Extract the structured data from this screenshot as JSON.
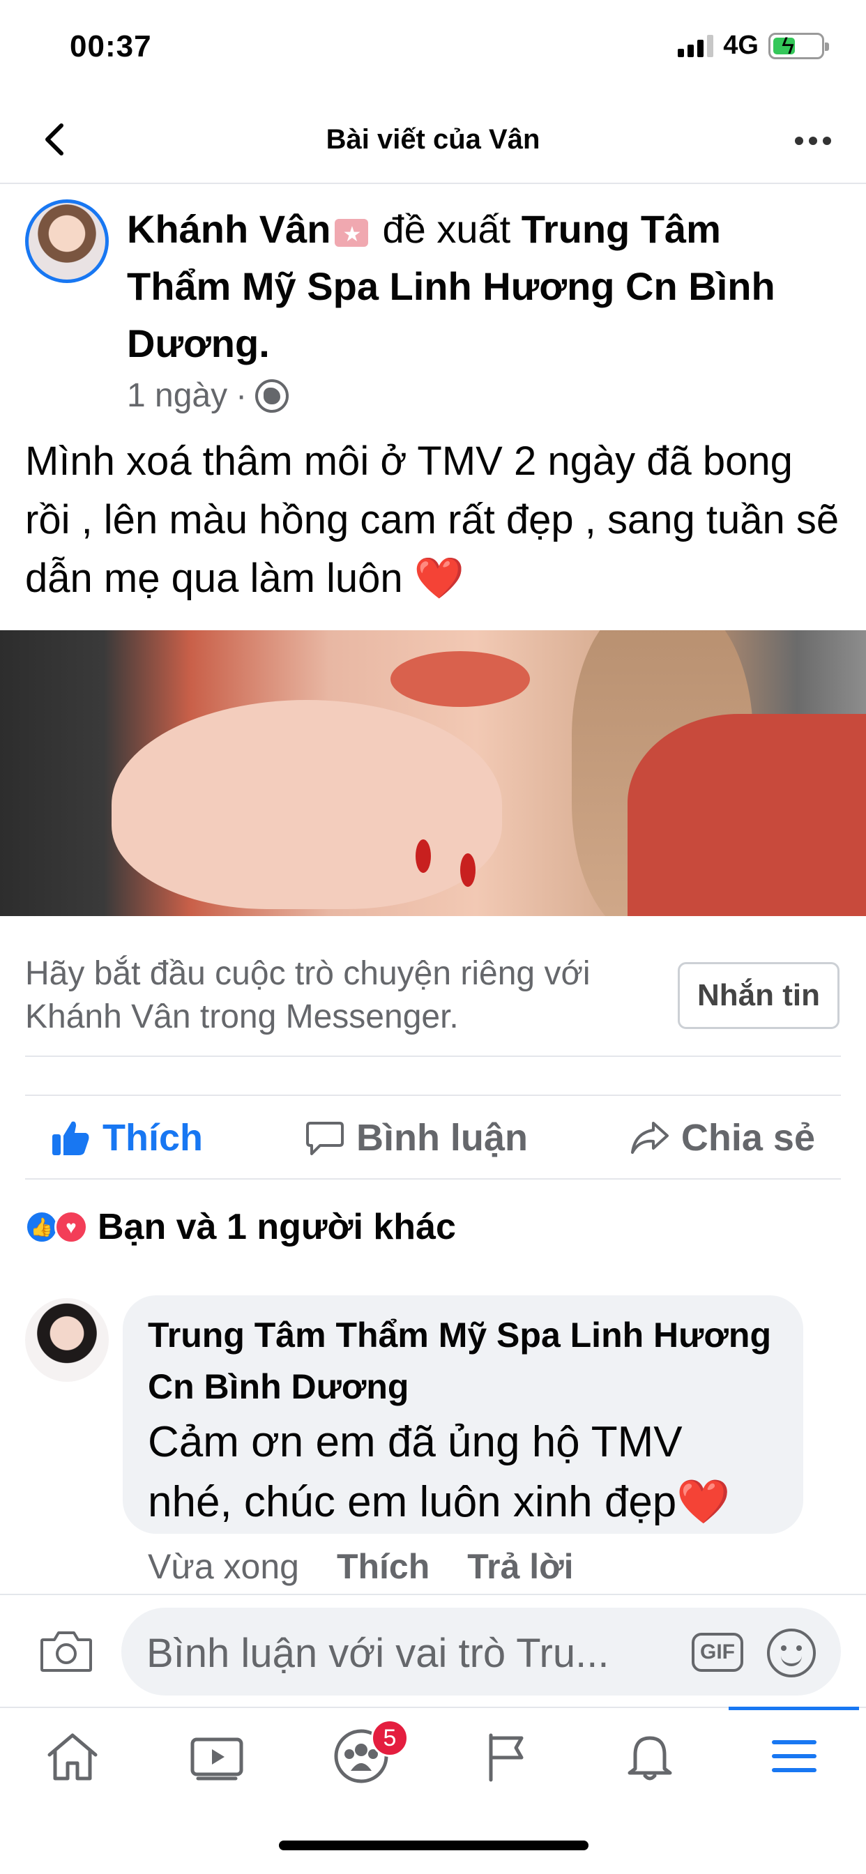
{
  "status": {
    "time": "00:37",
    "network": "4G",
    "battery_level": 0.45
  },
  "nav": {
    "title": "Bài viết của Vân"
  },
  "post": {
    "author": "Khánh Vân",
    "verb": "đề xuất",
    "page": "Trung Tâm Thẩm Mỹ Spa Linh Hương Cn Bình Dương.",
    "time": "1 ngày",
    "separator": "·",
    "text": "Mình xoá thâm môi ở TMV 2 ngày đã bong rồi , lên màu hồng cam rất đẹp , sang tuần sẽ dẫn mẹ qua làm luôn ❤️"
  },
  "messenger": {
    "prompt": "Hãy bắt đầu cuộc trò chuyện riêng với Khánh Vân trong Messenger.",
    "button": "Nhắn tin"
  },
  "actions": {
    "like": "Thích",
    "comment": "Bình luận",
    "share": "Chia sẻ"
  },
  "reactions": {
    "summary": "Bạn và 1 người khác"
  },
  "comment": {
    "author": "Trung Tâm Thẩm Mỹ Spa Linh Hương Cn Bình Dương",
    "text": "Cảm ơn em đã ủng hộ TMV nhé, chúc em luôn xinh đẹp❤️",
    "time": "Vừa xong",
    "like": "Thích",
    "reply": "Trả lời"
  },
  "composer": {
    "placeholder": "Bình luận với vai trò Tru...",
    "gif": "GIF"
  },
  "tabbar": {
    "groups_badge": "5"
  },
  "colors": {
    "accent": "#1877f2",
    "secondary_text": "#65676b",
    "bubble": "#f0f2f5",
    "badge": "#e41e3f"
  }
}
